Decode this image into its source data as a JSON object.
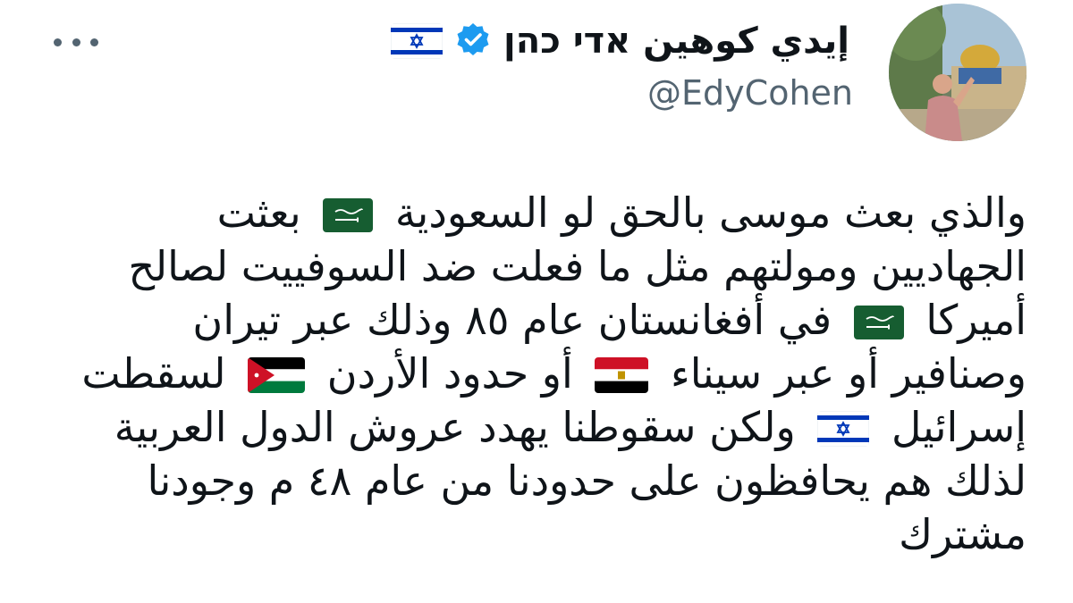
{
  "author": {
    "display_name": "إيدي كوهين אדי כהן",
    "name_flag": "israel-flag-icon",
    "verified": true,
    "verified_color": "#1d9bf0",
    "handle": "@EdyCohen"
  },
  "menu": {
    "more_icon": "more-horizontal-icon"
  },
  "tweet": {
    "lines": [
      {
        "parts": [
          {
            "text": "والذي بعث موسى بالحق لو السعودية "
          },
          {
            "flag": "saudi"
          },
          {
            "text": " بعثت"
          }
        ]
      },
      {
        "parts": [
          {
            "text": "الجهاديين ومولتهم مثل ما فعلت ضد السوفييت لصالح"
          }
        ]
      },
      {
        "parts": [
          {
            "text": "أميركا "
          },
          {
            "flag": "saudi"
          },
          {
            "text": " في أفغانستان عام ٨٥ وذلك عبر تيران"
          }
        ]
      },
      {
        "parts": [
          {
            "text": "وصنافير أو عبر سيناء "
          },
          {
            "flag": "egypt"
          },
          {
            "text": " أو حدود الأردن "
          },
          {
            "flag": "jordan"
          },
          {
            "text": " لسقطت"
          }
        ]
      },
      {
        "parts": [
          {
            "text": "إسرائيل "
          },
          {
            "flag": "israel"
          },
          {
            "text": " ولكن سقوطنا يهدد عروش الدول العربية"
          }
        ]
      },
      {
        "parts": [
          {
            "text": "لذلك هم يحافظون على حدودنا من عام ٤٨ م وجودنا"
          }
        ]
      },
      {
        "parts": [
          {
            "text": "مشترك"
          }
        ]
      }
    ]
  },
  "colors": {
    "text": "#0f1419",
    "secondary": "#536471",
    "saudi_green": "#165d31",
    "egypt_red": "#ce1126",
    "jordan_green": "#007a3d",
    "israel_blue": "#0038b8"
  }
}
